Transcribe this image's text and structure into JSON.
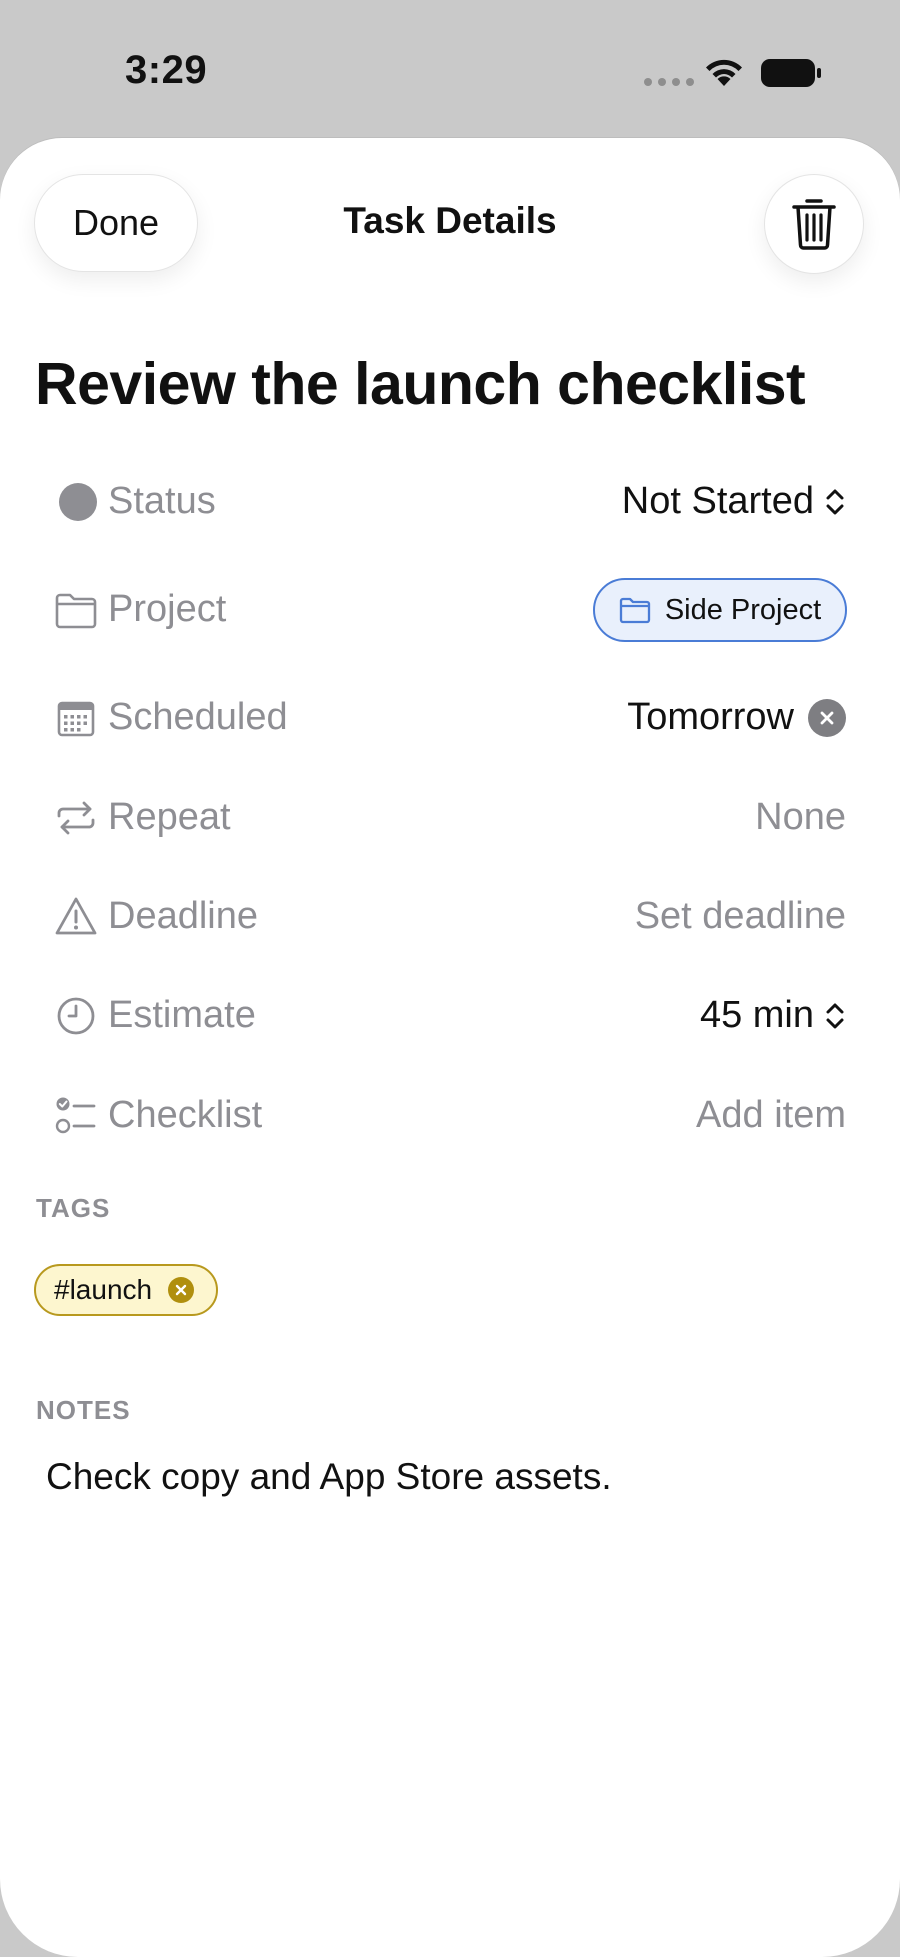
{
  "status_bar": {
    "time": "3:29"
  },
  "header": {
    "done_label": "Done",
    "title": "Task Details"
  },
  "task": {
    "title": "Review the launch checklist"
  },
  "properties": {
    "status": {
      "label": "Status",
      "value": "Not Started"
    },
    "project": {
      "label": "Project",
      "value": "Side Project"
    },
    "scheduled": {
      "label": "Scheduled",
      "value": "Tomorrow"
    },
    "repeat": {
      "label": "Repeat",
      "value": "None"
    },
    "deadline": {
      "label": "Deadline",
      "value": "Set deadline"
    },
    "estimate": {
      "label": "Estimate",
      "value": "45 min"
    },
    "checklist": {
      "label": "Checklist",
      "value": "Add item"
    }
  },
  "tags": {
    "header": "TAGS",
    "items": [
      "#launch"
    ]
  },
  "notes": {
    "header": "NOTES",
    "text": "Check copy and App Store assets."
  },
  "colors": {
    "project_accent": "#4a7cd6",
    "tag_accent": "#b8991e",
    "secondary_text": "#8e8e93"
  },
  "icons": {
    "status": "status-circle-icon",
    "project": "folder-icon",
    "scheduled": "calendar-icon",
    "repeat": "repeat-icon",
    "deadline": "warning-icon",
    "estimate": "clock-icon",
    "checklist": "checklist-icon",
    "delete": "trash-icon"
  }
}
